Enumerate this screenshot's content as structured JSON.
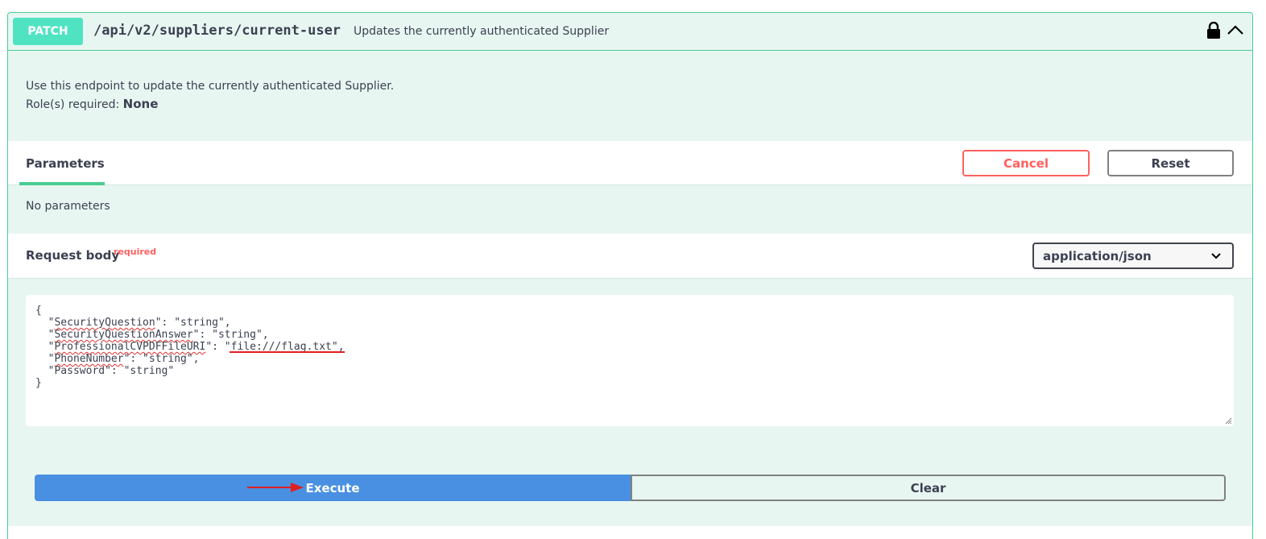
{
  "operation": {
    "method": "PATCH",
    "path": "/api/v2/suppliers/current-user",
    "summary": "Updates the currently authenticated Supplier"
  },
  "description": {
    "text": "Use this endpoint to update the currently authenticated Supplier.",
    "roles_label": "Role(s) required:",
    "roles_value": "None"
  },
  "parameters": {
    "tab_label": "Parameters",
    "cancel_label": "Cancel",
    "reset_label": "Reset",
    "empty_text": "No parameters"
  },
  "request_body": {
    "title": "Request body",
    "required_label": "required",
    "content_type": "application/json",
    "code_lines": {
      "open": "{",
      "k1": "SecurityQuestion",
      "v1": "\": \"string\",",
      "k2": "SecurityQuestionAnswer",
      "v2": "\": \"string\",",
      "k3": "ProfessionalCVPDFFileURI",
      "v3": "\": \"file:///flag.txt\",",
      "k4": "PhoneNumber",
      "v4": "\": \"string\",",
      "line5": "\"Password\": \"string\"",
      "close": "}"
    }
  },
  "actions": {
    "execute_label": "Execute",
    "clear_label": "Clear"
  },
  "colors": {
    "patch_accent": "#50e3c2",
    "border": "#49cc90",
    "execute": "#4990e2",
    "cancel": "#ff6060",
    "annotation": "#e02020"
  },
  "icons": [
    "lock-icon",
    "chevron-up-icon",
    "chevron-down-icon",
    "resize-handle-icon",
    "red-arrow-annotation"
  ]
}
